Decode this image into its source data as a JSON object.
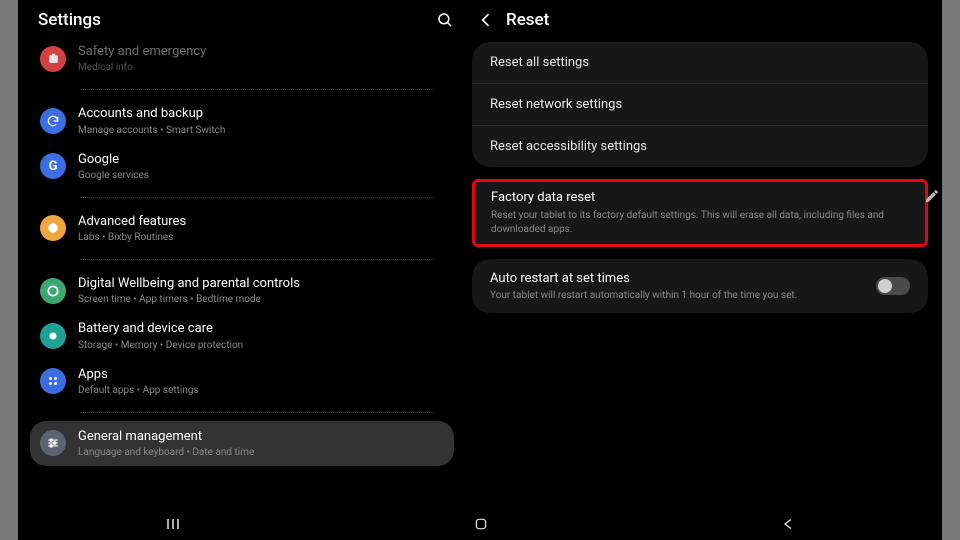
{
  "left_header": {
    "title": "Settings"
  },
  "settings": {
    "safety": {
      "title": "Safety and emergency",
      "sub": "Medical info",
      "color": "#e94a4a"
    },
    "accounts": {
      "title": "Accounts and backup",
      "sub": "Manage accounts  •  Smart Switch",
      "color": "#3b6ee0"
    },
    "google": {
      "title": "Google",
      "sub": "Google services",
      "color": "#3b6ee0"
    },
    "advanced": {
      "title": "Advanced features",
      "sub": "Labs  •  Bixby Routines",
      "color": "#f0a63e"
    },
    "wellbeing": {
      "title": "Digital Wellbeing and parental controls",
      "sub": "Screen time  •  App timers  •  Bedtime mode",
      "color": "#3ba870"
    },
    "battery": {
      "title": "Battery and device care",
      "sub": "Storage  •  Memory  •  Device protection",
      "color": "#1fa196"
    },
    "apps": {
      "title": "Apps",
      "sub": "Default apps  •  App settings",
      "color": "#3b6ee0"
    },
    "general": {
      "title": "General management",
      "sub": "Language and keyboard  •  Date and time",
      "color": "#5a6472"
    }
  },
  "right_header": {
    "title": "Reset"
  },
  "reset_rows": {
    "all": "Reset all settings",
    "net": "Reset network settings",
    "acc": "Reset accessibility settings"
  },
  "factory": {
    "title": "Factory data reset",
    "desc": "Reset your tablet to its factory default settings. This will erase all data, including files and downloaded apps."
  },
  "auto_restart": {
    "title": "Auto restart at set times",
    "desc": "Your tablet will restart automatically within 1 hour of the time you set.",
    "enabled": false
  }
}
